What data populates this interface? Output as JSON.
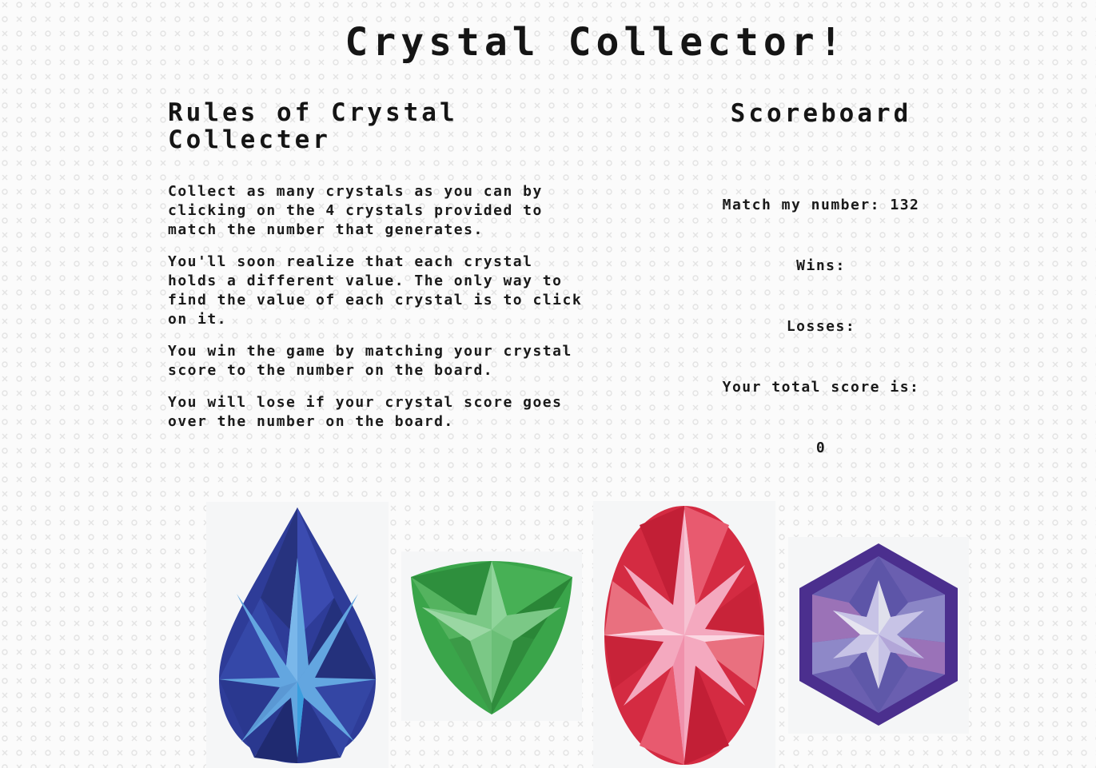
{
  "title": "Crystal Collector!",
  "rules": {
    "heading": "Rules of Crystal Collecter",
    "paragraphs": [
      "Collect as many crystals as you can by clicking on the 4 crystals provided to match the number that generates.",
      "You'll soon realize that each crystal holds a different value. The only way to find the value of each crystal is to click on it.",
      "You win the game by matching your crystal score to the number on the board.",
      "You will lose if your crystal score goes over the number on the board."
    ]
  },
  "scoreboard": {
    "heading": "Scoreboard",
    "match_label": "Match my number:",
    "match_value": "132",
    "wins_label": "Wins:",
    "wins_value": "",
    "losses_label": "Losses:",
    "losses_value": "",
    "total_label": "Your total score is:",
    "total_value": "0"
  },
  "crystals": [
    {
      "name": "blue-crystal-icon",
      "shape": "teardrop",
      "color": "#2a3a96"
    },
    {
      "name": "green-crystal-icon",
      "shape": "shield",
      "color": "#3aa54a"
    },
    {
      "name": "red-crystal-icon",
      "shape": "oval",
      "color": "#d6283e"
    },
    {
      "name": "purple-crystal-icon",
      "shape": "hexagon",
      "color": "#5a3f9e"
    }
  ]
}
